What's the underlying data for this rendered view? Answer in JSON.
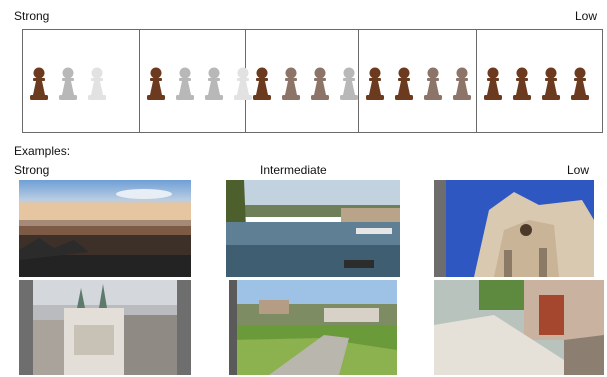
{
  "scale": {
    "strong_label": "Strong",
    "low_label": "Low",
    "groups": [
      {
        "pawns": [
          "dark",
          "faded",
          "faint"
        ]
      },
      {
        "pawns": [
          "dark",
          "faded",
          "faded",
          "faint"
        ]
      },
      {
        "pawns": [
          "dark",
          "medium",
          "medium",
          "faded"
        ]
      },
      {
        "pawns": [
          "dark",
          "dark",
          "medium",
          "medium"
        ]
      },
      {
        "pawns": [
          "dark",
          "dark",
          "dark",
          "dark"
        ]
      }
    ]
  },
  "examples": {
    "heading": "Examples:",
    "strong_label": "Strong",
    "intermediate_label": "Intermediate",
    "low_label": "Low"
  },
  "colors": {
    "pawn_dark": "#6b3a1f",
    "pawn_medium": "#8d7468",
    "pawn_faded": "#b8b8b8",
    "pawn_faint": "#e2e2e2",
    "border": "#6a6a6a"
  }
}
